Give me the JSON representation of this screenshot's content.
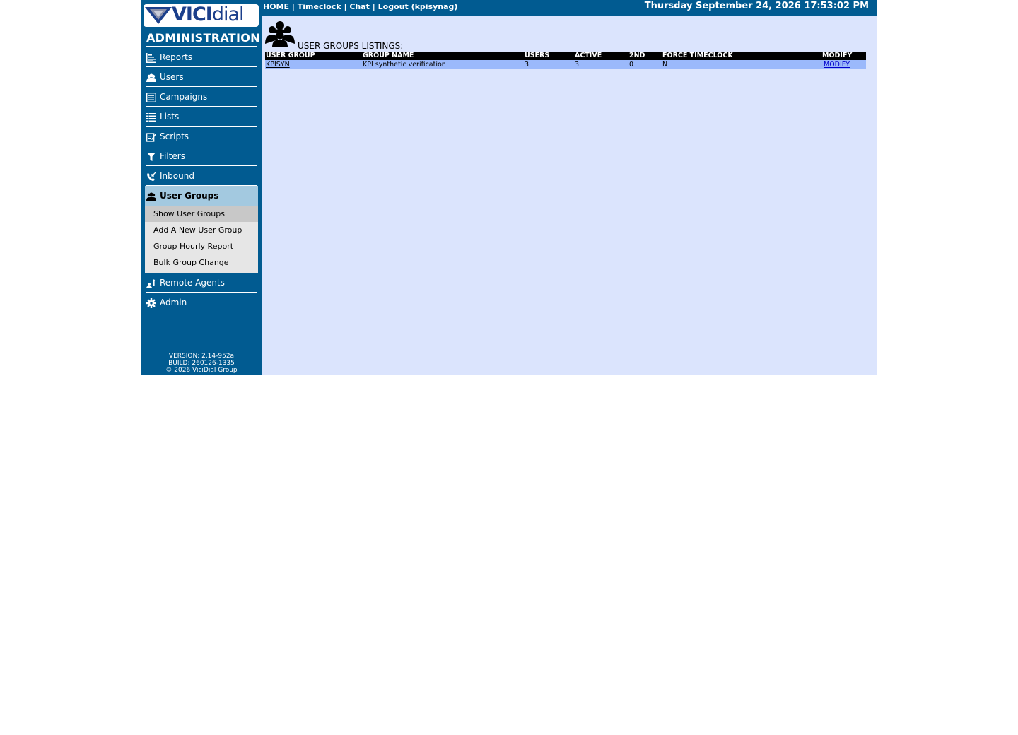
{
  "sidebar": {
    "logo": {
      "vici": "VICI",
      "dial": "dial"
    },
    "admin_title": "ADMINISTRATION",
    "items": [
      {
        "label": "Reports"
      },
      {
        "label": "Users"
      },
      {
        "label": "Campaigns"
      },
      {
        "label": "Lists"
      },
      {
        "label": "Scripts"
      },
      {
        "label": "Filters"
      },
      {
        "label": "Inbound"
      },
      {
        "label": "User Groups",
        "active": true
      },
      {
        "label": "Remote Agents"
      },
      {
        "label": "Admin"
      }
    ],
    "user_groups_sub": [
      {
        "label": "Show User Groups",
        "current": true
      },
      {
        "label": "Add A New User Group"
      },
      {
        "label": "Group Hourly Report"
      },
      {
        "label": "Bulk Group Change"
      }
    ],
    "version": "VERSION: 2.14-952a",
    "build": "BUILD: 260126-1335",
    "copyright": "© 2026 ViciDial Group"
  },
  "topbar": {
    "home": "HOME",
    "timeclock": "Timeclock",
    "chat": "Chat",
    "logout": "Logout (kpisynag)",
    "sep": "|",
    "datetime": "Thursday September 24, 2026 17:53:02 PM"
  },
  "page": {
    "title": "USER GROUPS LISTINGS:"
  },
  "table": {
    "headers": [
      "USER GROUP",
      "GROUP NAME",
      "USERS",
      "ACTIVE",
      "2ND",
      "FORCE TIMECLOCK",
      "MODIFY"
    ],
    "rows": [
      {
        "user_group": "KPISYN",
        "group_name": "KPI synthetic verification",
        "users": "3",
        "active": "3",
        "second": "0",
        "force_timeclock": "N",
        "modify": "MODIFY"
      }
    ]
  },
  "colors": {
    "sidebar_bg": "#015b91",
    "main_bg": "#dbe4fd",
    "row_bg": "#9bb9fb",
    "active_nav_bg": "#a3c9e0"
  }
}
